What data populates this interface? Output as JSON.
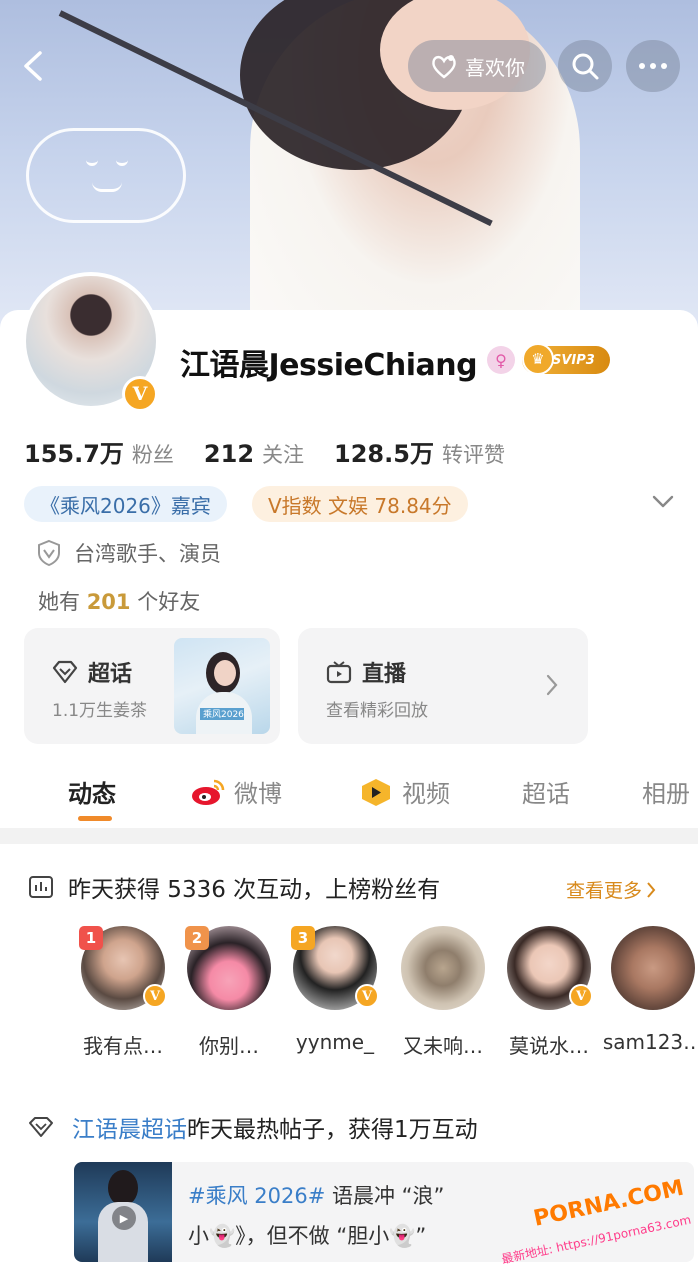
{
  "header": {
    "like_label": "喜欢你",
    "back_icon": "chevron-left-icon",
    "search_icon": "search-icon",
    "more_icon": "more-dots-icon"
  },
  "profile": {
    "name": "江语晨JessieChiang",
    "verified_mark": "V",
    "svip_label": "SVIP3",
    "stats": [
      {
        "value": "155.7万",
        "label": "粉丝"
      },
      {
        "value": "212",
        "label": "关注"
      },
      {
        "value": "128.5万",
        "label": "转评赞"
      }
    ],
    "guest_chip": "《乘风2026》嘉宾",
    "vindex_chip": "V指数 文娱 78.84分",
    "occupation": "台湾歌手、演员",
    "friends_prefix": "她有",
    "friends_count": "201",
    "friends_suffix": "个好友"
  },
  "features": {
    "super": {
      "title": "超话",
      "sub": "1.1万生姜茶",
      "thumb_tag": "乘风2026"
    },
    "live": {
      "title": "直播",
      "sub": "查看精彩回放"
    }
  },
  "tabs": [
    {
      "label": "动态"
    },
    {
      "label": "微博"
    },
    {
      "label": "视频"
    },
    {
      "label": "超话"
    },
    {
      "label": "相册"
    }
  ],
  "fans": {
    "heading": "昨天获得 5336 次互动，上榜粉丝有",
    "more_label": "查看更多",
    "list": [
      {
        "rank": "1",
        "name": "我有点…"
      },
      {
        "rank": "2",
        "name": "你别…"
      },
      {
        "rank": "3",
        "name": "yynme_"
      },
      {
        "rank": "",
        "name": "又未响…"
      },
      {
        "rank": "",
        "name": "莫说水…"
      },
      {
        "rank": "",
        "name": "sam123…"
      }
    ]
  },
  "hot_post": {
    "link": "江语晨超话",
    "heading_rest": "昨天最热帖子，获得1万互动",
    "line1_tag": "#乘风 2026#",
    "line1_rest": " 语晨冲 “浪”",
    "line2": "小👻》，但不做 “胆小👻”"
  },
  "watermark": {
    "brand": "PORNA.COM",
    "url": "最新地址: https://91porna63.com"
  },
  "colors": {
    "accent_orange": "#f08a2a",
    "link_blue": "#3a7ec8",
    "gold": "#f5a623"
  }
}
